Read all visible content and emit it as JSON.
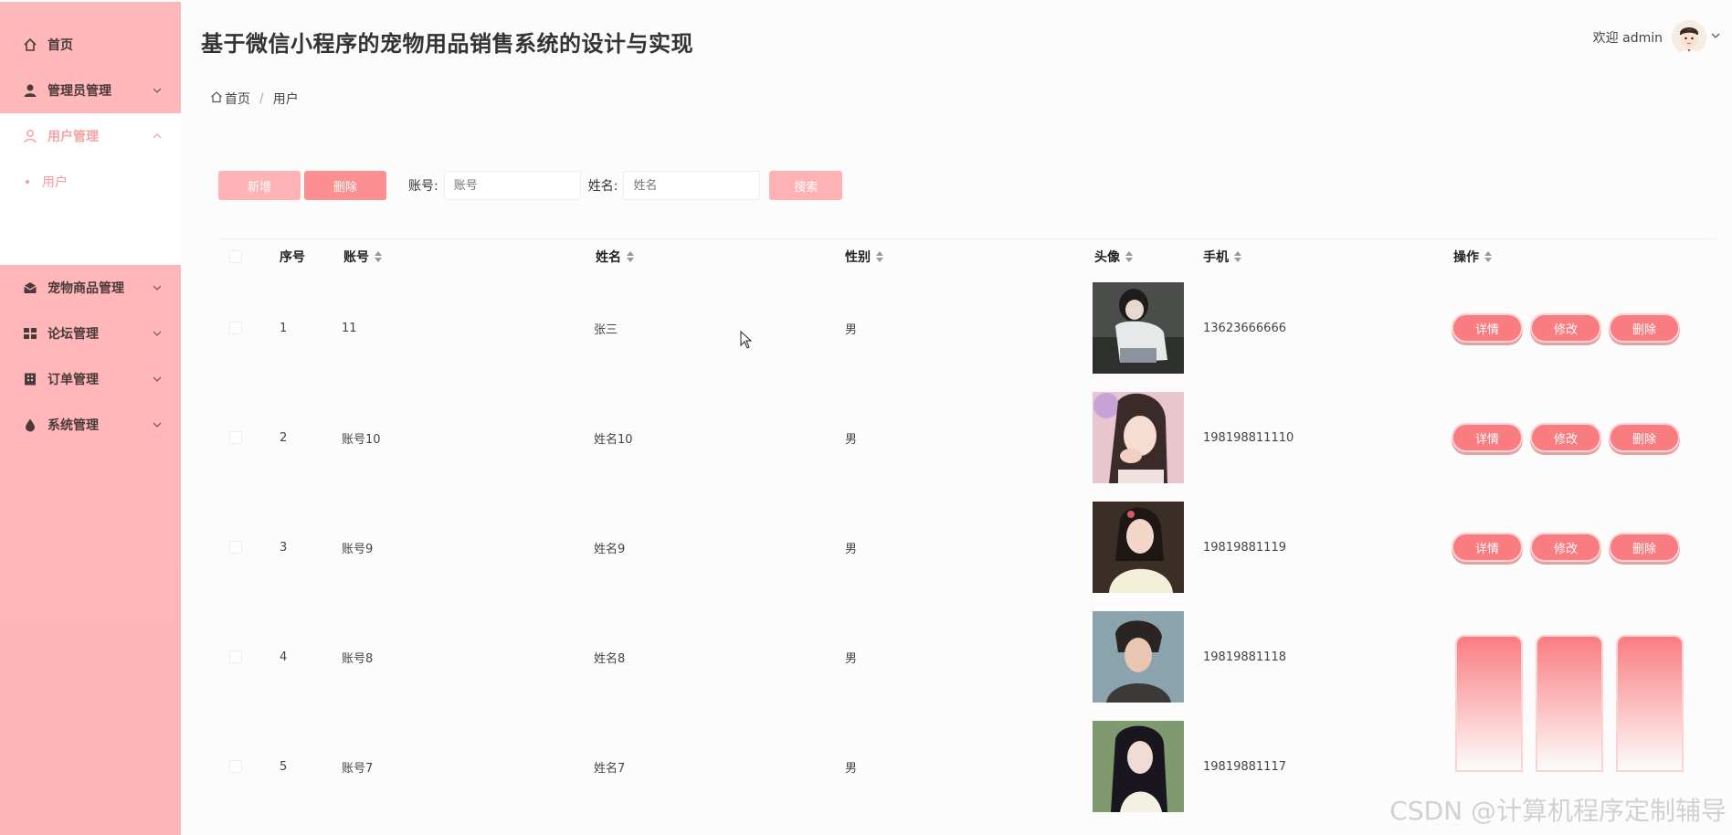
{
  "app": {
    "title": "基于微信小程序的宠物用品销售系统的设计与实现",
    "welcome": "欢迎 admin"
  },
  "sidebar": {
    "items": [
      {
        "label": "首页",
        "icon": "home-icon"
      },
      {
        "label": "管理员管理",
        "icon": "user-icon"
      },
      {
        "label": "用户管理",
        "icon": "user-outline-icon",
        "open": true
      },
      {
        "label": "宠物商品管理",
        "icon": "mail-icon"
      },
      {
        "label": "论坛管理",
        "icon": "grid-icon"
      },
      {
        "label": "订单管理",
        "icon": "building-icon"
      },
      {
        "label": "系统管理",
        "icon": "drop-icon"
      }
    ],
    "submenu": [
      {
        "label": "用户"
      }
    ]
  },
  "breadcrumb": {
    "home": "首页",
    "current": "用户",
    "separator": "/"
  },
  "toolbar": {
    "add_label": "新增",
    "delete_label": "删除",
    "account_label": "账号:",
    "account_placeholder": "账号",
    "name_label": "姓名:",
    "name_placeholder": "姓名",
    "search_label": "搜索"
  },
  "table": {
    "headers": [
      "序号",
      "账号",
      "姓名",
      "性别",
      "头像",
      "手机",
      "操作"
    ],
    "rows": [
      {
        "no": "1",
        "account": "11",
        "name": "张三",
        "gender": "男",
        "phone": "13623666666"
      },
      {
        "no": "2",
        "account": "账号10",
        "name": "姓名10",
        "gender": "男",
        "phone": "198198811110"
      },
      {
        "no": "3",
        "account": "账号9",
        "name": "姓名9",
        "gender": "男",
        "phone": "19819881119"
      },
      {
        "no": "4",
        "account": "账号8",
        "name": "姓名8",
        "gender": "男",
        "phone": "19819881118"
      },
      {
        "no": "5",
        "account": "账号7",
        "name": "姓名7",
        "gender": "男",
        "phone": "19819881117"
      }
    ],
    "actions": {
      "detail": "详情",
      "edit": "修改",
      "delete": "删除"
    }
  },
  "watermark": "CSDN @计算机程序定制辅导",
  "colors": {
    "sidebar": "#ffb8ba",
    "accent": "#f97d80",
    "active_text": "#f49da0"
  }
}
